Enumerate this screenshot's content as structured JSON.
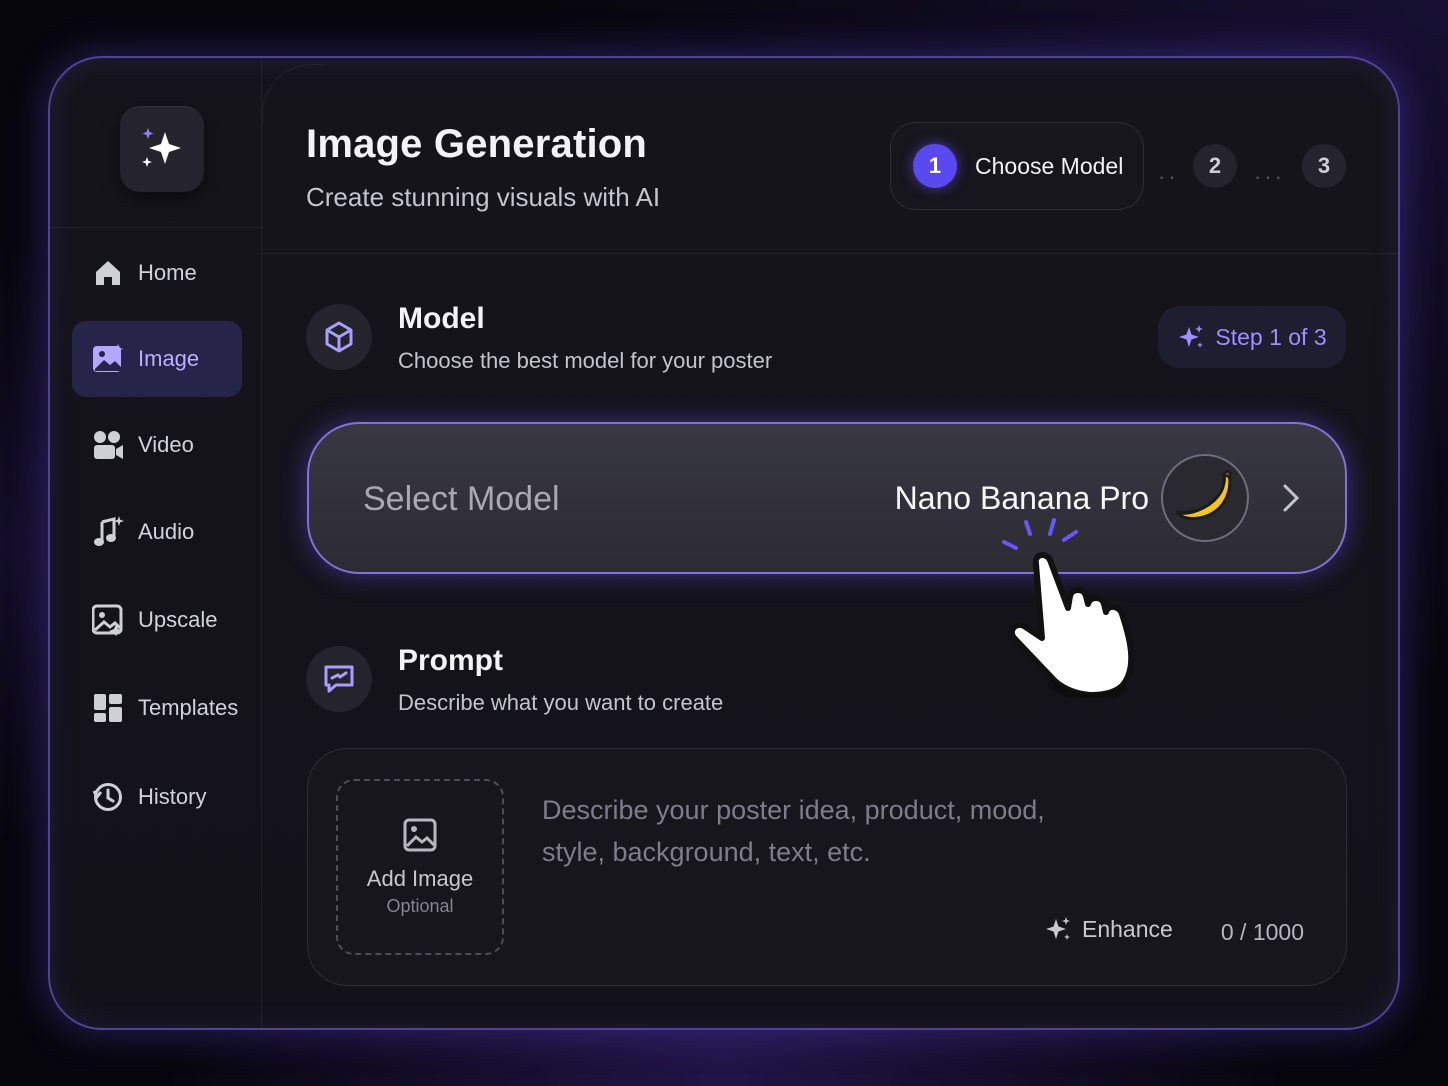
{
  "sidebar": {
    "items": [
      {
        "label": "Home",
        "icon": "home-icon"
      },
      {
        "label": "Image",
        "icon": "image-icon",
        "active": true
      },
      {
        "label": "Video",
        "icon": "video-icon"
      },
      {
        "label": "Audio",
        "icon": "music-icon"
      },
      {
        "label": "Upscale",
        "icon": "upscale-icon"
      },
      {
        "label": "Templates",
        "icon": "templates-icon"
      },
      {
        "label": "History",
        "icon": "history-icon"
      }
    ]
  },
  "header": {
    "title": "Image Generation",
    "subtitle": "Create stunning visuals with AI"
  },
  "stepper": {
    "current": "1",
    "current_label": "Choose Model",
    "step2": "2",
    "step3": "3"
  },
  "model_section": {
    "title": "Model",
    "subtitle": "Choose the best model for your poster",
    "badge": "Step 1 of 3",
    "select_label": "Select Model",
    "selected_value": "Nano Banana Pro"
  },
  "prompt_section": {
    "title": "Prompt",
    "subtitle": "Describe what you want to create",
    "add_image_label": "Add Image",
    "add_image_hint": "Optional",
    "placeholder": "Describe your poster idea, product, mood, style, background, text, etc.",
    "enhance_label": "Enhance",
    "counter": "0 / 1000"
  },
  "colors": {
    "accent": "#5a48f0",
    "accent_light": "#9d8fff",
    "background": "#131219"
  }
}
